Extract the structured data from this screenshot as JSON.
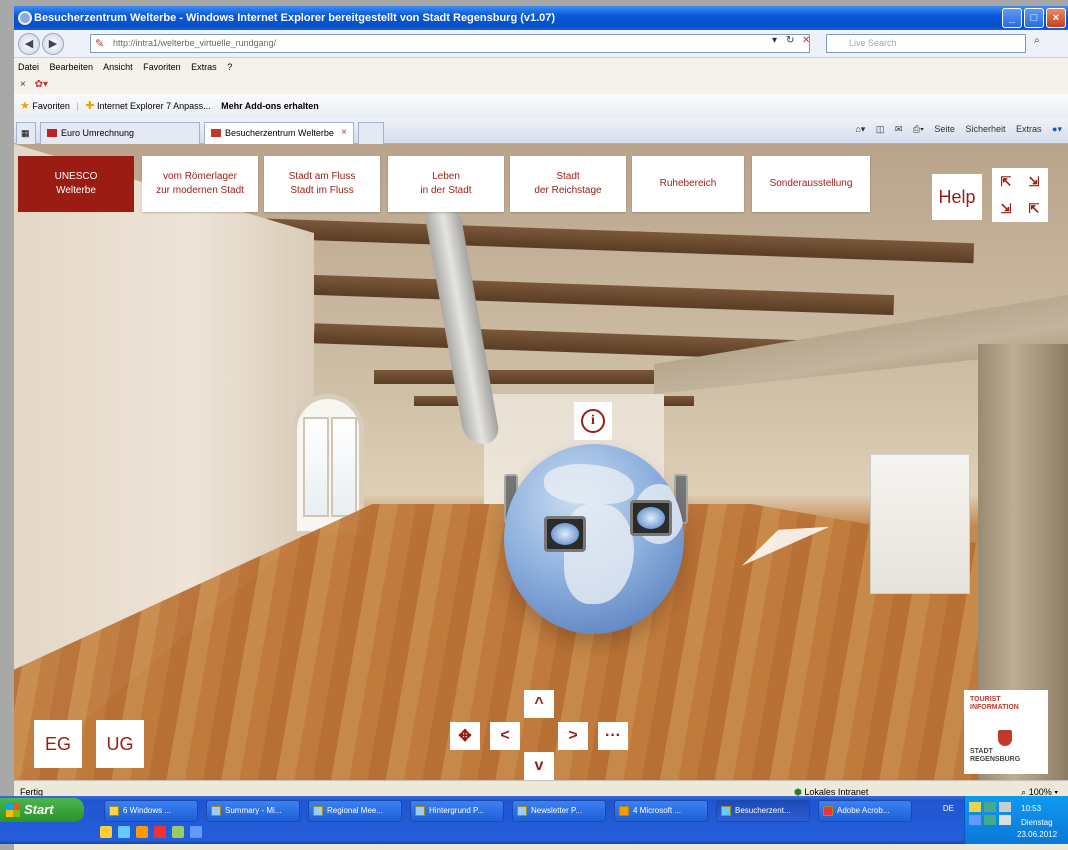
{
  "window": {
    "title": "Besucherzentrum Welterbe - Windows Internet Explorer bereitgestellt von Stadt Regensburg (v1.07)"
  },
  "address": {
    "url": "http://intra1/welterbe_virtuelle_rundgang/",
    "search_placeholder": "Live Search"
  },
  "menu": {
    "items": [
      "Datei",
      "Bearbeiten",
      "Ansicht",
      "Favoriten",
      "Extras",
      "?"
    ]
  },
  "favorites_bar": {
    "favorites_label": "Favoriten",
    "link1": "Internet Explorer 7 Anpass...",
    "link2": "Mehr Add-ons erhalten"
  },
  "tabs": [
    {
      "label": "Euro Umrechnung"
    },
    {
      "label": "Besucherzentrum Welterbe"
    }
  ],
  "command_bar": {
    "page": "Seite",
    "security": "Sicherheit",
    "extras": "Extras"
  },
  "tour": {
    "unesco": "UNESCO\nWelterbe",
    "nav": [
      "vom Römerlager\nzur modernen Stadt",
      "Stadt am Fluss\nStadt im Fluss",
      "Leben\nin der Stadt",
      "Stadt\nder Reichstage",
      "Ruhebereich",
      "Sonderausstellung"
    ],
    "help": "Help",
    "info_glyph": "i",
    "floor_eg": "EG",
    "floor_ug": "UG",
    "arrows": {
      "up": "^",
      "down": "v",
      "left": "<",
      "right": ">",
      "move": "✥",
      "more": "···"
    },
    "fullscreen_glyphs": [
      "⇱",
      "⇲",
      "⇲",
      "⇱"
    ],
    "tourist_info": {
      "top": "TOURIST\nINFORMATION",
      "bottom": "STADT\nREGENSBURG"
    }
  },
  "status": {
    "left": "Fertig",
    "zone": "Lokales Intranet",
    "zoom": "100%"
  },
  "taskbar": {
    "start": "Start",
    "items": [
      "6 Windows ...",
      "Summary - Mi...",
      "Regional Mee...",
      "Hintergrund P...",
      "Newsletter P...",
      "4 Microsoft ...",
      "Besucherzent...",
      "Adobe Acrob..."
    ],
    "lang": "DE",
    "time": "10:53",
    "day": "Dienstag",
    "date": "23.06.2012"
  },
  "colors": {
    "brand_red": "#9b1c12",
    "xp_blue": "#245edb"
  }
}
